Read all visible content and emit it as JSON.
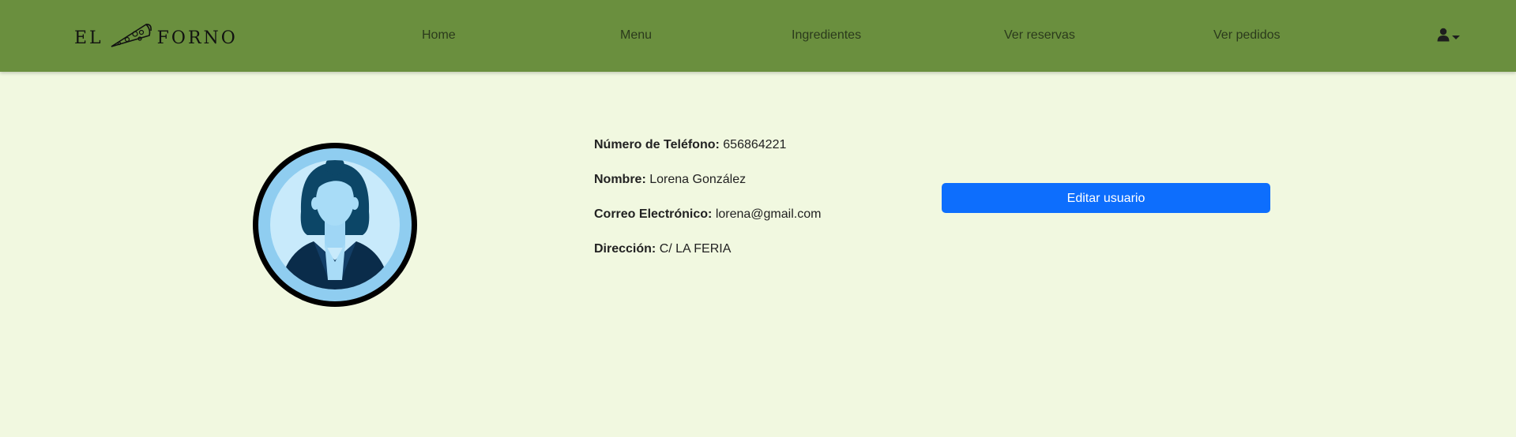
{
  "brand": {
    "left": "EL",
    "right": "FORNO"
  },
  "nav": {
    "items": [
      {
        "label": "Home"
      },
      {
        "label": "Menu"
      },
      {
        "label": "Ingredientes"
      },
      {
        "label": "Ver reservas"
      },
      {
        "label": "Ver pedidos"
      }
    ],
    "user_menu_icon": "user-icon"
  },
  "profile": {
    "phone_label": "Número de Teléfono:",
    "phone_value": "656864221",
    "name_label": "Nombre:",
    "name_value": "Lorena González",
    "email_label": "Correo Electrónico:",
    "email_value": "lorena@gmail.com",
    "address_label": "Dirección:",
    "address_value": "C/ LA FERIA"
  },
  "actions": {
    "edit_label": "Editar usuario"
  },
  "colors": {
    "navbar": "#6a8f3e",
    "page_bg": "#f1f8e0",
    "primary_button": "#0d6efd"
  }
}
